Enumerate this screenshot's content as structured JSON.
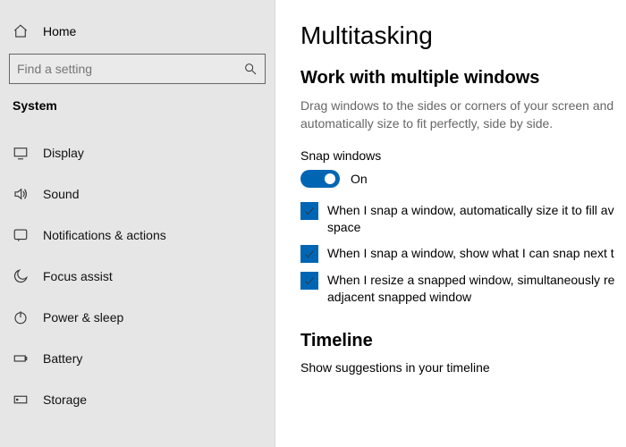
{
  "sidebar": {
    "home_label": "Home",
    "search_placeholder": "Find a setting",
    "category": "System",
    "items": [
      {
        "label": "Display"
      },
      {
        "label": "Sound"
      },
      {
        "label": "Notifications & actions"
      },
      {
        "label": "Focus assist"
      },
      {
        "label": "Power & sleep"
      },
      {
        "label": "Battery"
      },
      {
        "label": "Storage"
      }
    ]
  },
  "main": {
    "title": "Multitasking",
    "windows_section": {
      "heading": "Work with multiple windows",
      "description": "Drag windows to the sides or corners of your screen and\nautomatically size to fit perfectly, side by side.",
      "snap_label": "Snap windows",
      "toggle_state": "On",
      "checks": [
        "When I snap a window, automatically size it to fill av\nspace",
        "When I snap a window, show what I can snap next t",
        "When I resize a snapped window, simultaneously re\nadjacent snapped window"
      ]
    },
    "timeline_section": {
      "heading": "Timeline",
      "subtext": "Show suggestions in your timeline"
    }
  }
}
